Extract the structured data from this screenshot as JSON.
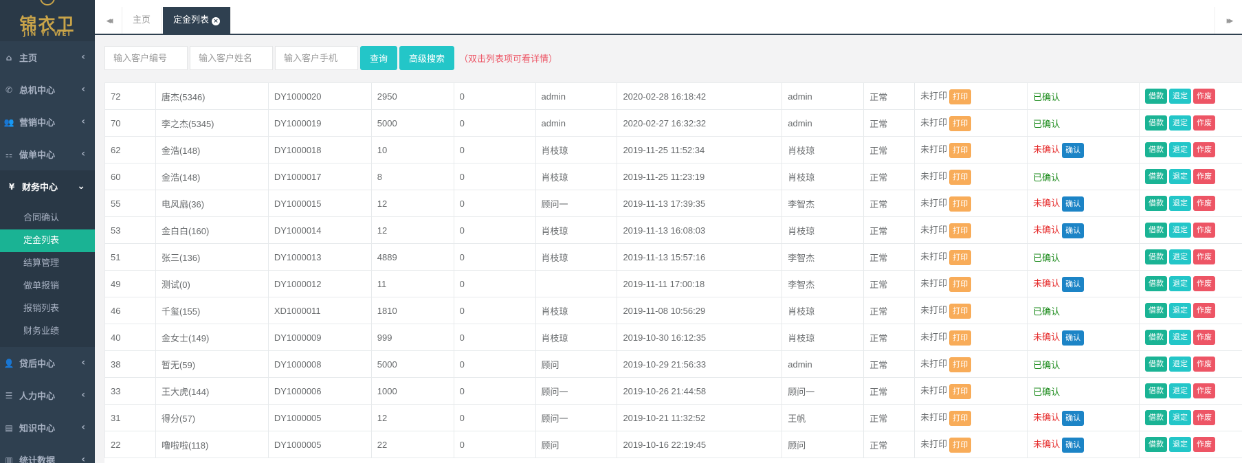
{
  "logo": {
    "brand": "锦衣卫",
    "subtitle": "JIN YI WEI"
  },
  "sidebar": {
    "items": [
      {
        "label": "主页",
        "icon": "home-icon",
        "glyph": "⌂"
      },
      {
        "label": "总机中心",
        "icon": "phone-icon",
        "glyph": "✆"
      },
      {
        "label": "营销中心",
        "icon": "users-icon",
        "glyph": "👥"
      },
      {
        "label": "做单中心",
        "icon": "sitemap-icon",
        "glyph": "⚏"
      },
      {
        "label": "财务中心",
        "icon": "yen-icon",
        "glyph": "¥"
      },
      {
        "label": "贷后中心",
        "icon": "user-plus-icon",
        "glyph": "👤"
      },
      {
        "label": "人力中心",
        "icon": "list-icon",
        "glyph": "☰"
      },
      {
        "label": "知识中心",
        "icon": "book-icon",
        "glyph": "▤"
      },
      {
        "label": "统计数据",
        "icon": "bar-chart-icon",
        "glyph": "▥"
      }
    ],
    "finance_sub": [
      "合同确认",
      "定金列表",
      "结算管理",
      "做单报销",
      "报销列表",
      "财务业绩"
    ]
  },
  "tabs": {
    "home": "主页",
    "active": "定金列表",
    "close": "×",
    "prev": "◀◀",
    "next": "▶▶"
  },
  "search": {
    "p_no": "输入客户编号",
    "p_name": "输入客户姓名",
    "p_phone": "输入客户手机",
    "query_label": "查询",
    "advanced_label": "高级搜索",
    "hint": "（双击列表项可看详情）"
  },
  "actions": {
    "print": "打印",
    "confirm": "确认",
    "loan": "借款",
    "refund": "退定",
    "void": "作废"
  },
  "rows": [
    {
      "id": "72",
      "customer": "唐杰(5346)",
      "code": "DY1000020",
      "amount": "2950",
      "other": "0",
      "advisor": "admin",
      "time": "2020-02-28 16:18:42",
      "operator": "admin",
      "status": "正常",
      "print": "未打印",
      "confirm": "已确认",
      "confirmed": true
    },
    {
      "id": "70",
      "customer": "李之杰(5345)",
      "code": "DY1000019",
      "amount": "5000",
      "other": "0",
      "advisor": "admin",
      "time": "2020-02-27 16:32:32",
      "operator": "admin",
      "status": "正常",
      "print": "未打印",
      "confirm": "已确认",
      "confirmed": true
    },
    {
      "id": "62",
      "customer": "金浩(148)",
      "code": "DY1000018",
      "amount": "10",
      "other": "0",
      "advisor": "肖枝琼",
      "time": "2019-11-25 11:52:34",
      "operator": "肖枝琼",
      "status": "正常",
      "print": "未打印",
      "confirm": "未确认",
      "confirmed": false
    },
    {
      "id": "60",
      "customer": "金浩(148)",
      "code": "DY1000017",
      "amount": "8",
      "other": "0",
      "advisor": "肖枝琼",
      "time": "2019-11-25 11:23:19",
      "operator": "肖枝琼",
      "status": "正常",
      "print": "未打印",
      "confirm": "已确认",
      "confirmed": true
    },
    {
      "id": "55",
      "customer": "电风扇(36)",
      "code": "DY1000015",
      "amount": "12",
      "other": "0",
      "advisor": "顾问一",
      "time": "2019-11-13 17:39:35",
      "operator": "李智杰",
      "status": "正常",
      "print": "未打印",
      "confirm": "未确认",
      "confirmed": false
    },
    {
      "id": "53",
      "customer": "金白白(160)",
      "code": "DY1000014",
      "amount": "12",
      "other": "0",
      "advisor": "肖枝琼",
      "time": "2019-11-13 16:08:03",
      "operator": "肖枝琼",
      "status": "正常",
      "print": "未打印",
      "confirm": "未确认",
      "confirmed": false
    },
    {
      "id": "51",
      "customer": "张三(136)",
      "code": "DY1000013",
      "amount": "4889",
      "other": "0",
      "advisor": "肖枝琼",
      "time": "2019-11-13 15:57:16",
      "operator": "李智杰",
      "status": "正常",
      "print": "未打印",
      "confirm": "已确认",
      "confirmed": true
    },
    {
      "id": "49",
      "customer": "测试(0)",
      "code": "DY1000012",
      "amount": "11",
      "other": "0",
      "advisor": "",
      "time": "2019-11-11 17:00:18",
      "operator": "李智杰",
      "status": "正常",
      "print": "未打印",
      "confirm": "未确认",
      "confirmed": false
    },
    {
      "id": "46",
      "customer": "千玺(155)",
      "code": "XD1000011",
      "amount": "1810",
      "other": "0",
      "advisor": "肖枝琼",
      "time": "2019-11-08 10:56:29",
      "operator": "肖枝琼",
      "status": "正常",
      "print": "未打印",
      "confirm": "已确认",
      "confirmed": true
    },
    {
      "id": "40",
      "customer": "金女士(149)",
      "code": "DY1000009",
      "amount": "999",
      "other": "0",
      "advisor": "肖枝琼",
      "time": "2019-10-30 16:12:35",
      "operator": "肖枝琼",
      "status": "正常",
      "print": "未打印",
      "confirm": "未确认",
      "confirmed": false
    },
    {
      "id": "38",
      "customer": "暂无(59)",
      "code": "DY1000008",
      "amount": "5000",
      "other": "0",
      "advisor": "顾问",
      "time": "2019-10-29 21:56:33",
      "operator": "admin",
      "status": "正常",
      "print": "未打印",
      "confirm": "已确认",
      "confirmed": true
    },
    {
      "id": "33",
      "customer": "王大虎(144)",
      "code": "DY1000006",
      "amount": "1000",
      "other": "0",
      "advisor": "顾问一",
      "time": "2019-10-26 21:44:58",
      "operator": "顾问一",
      "status": "正常",
      "print": "未打印",
      "confirm": "已确认",
      "confirmed": true
    },
    {
      "id": "31",
      "customer": "得分(57)",
      "code": "DY1000005",
      "amount": "12",
      "other": "0",
      "advisor": "顾问一",
      "time": "2019-10-21 11:32:52",
      "operator": "王帆",
      "status": "正常",
      "print": "未打印",
      "confirm": "未确认",
      "confirmed": false
    },
    {
      "id": "22",
      "customer": "噜啦啦(118)",
      "code": "DY1000005",
      "amount": "22",
      "other": "0",
      "advisor": "顾问",
      "time": "2019-10-16 22:19:45",
      "operator": "顾问",
      "status": "正常",
      "print": "未打印",
      "confirm": "未确认",
      "confirmed": false
    }
  ]
}
